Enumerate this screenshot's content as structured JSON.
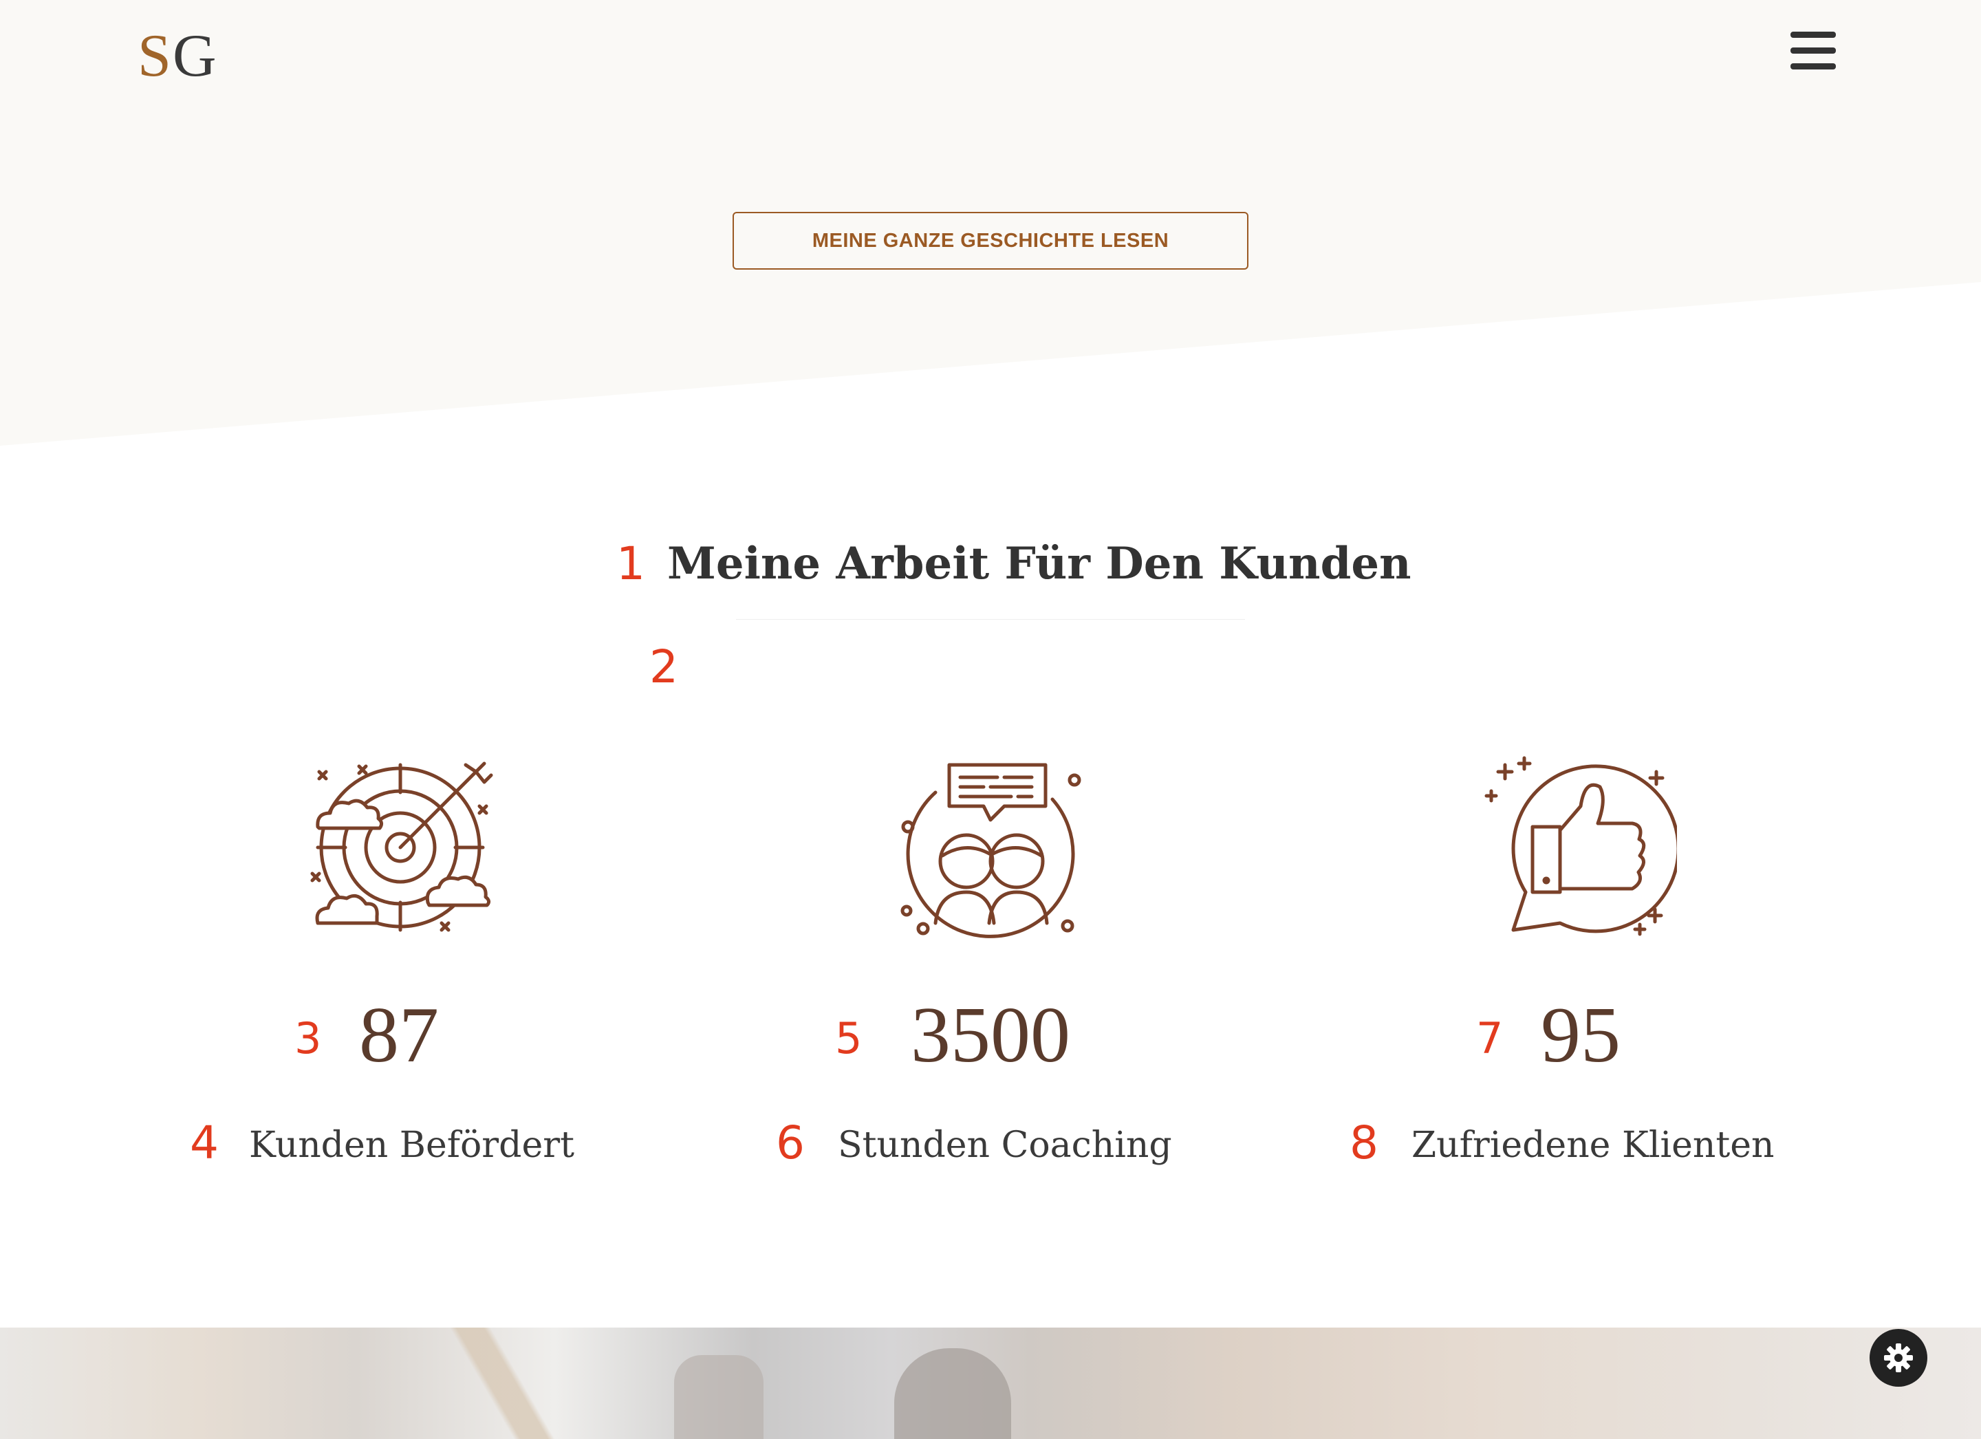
{
  "header": {
    "logo_s": "S",
    "logo_g": "G",
    "menu_icon": "hamburger-icon"
  },
  "hero": {
    "button_label": "MEINE GANZE GESCHICHTE LESEN"
  },
  "section": {
    "title": "Meine Arbeit Für Den Kunden",
    "markers": [
      "1",
      "2",
      "3",
      "4",
      "5",
      "6",
      "7",
      "8"
    ]
  },
  "stats": [
    {
      "icon": "target-arrow-icon",
      "value": "87",
      "label": "Kunden Befördert"
    },
    {
      "icon": "coaching-chat-icon",
      "value": "3500",
      "label": "Stunden Coaching"
    },
    {
      "icon": "thumbs-up-icon",
      "value": "95",
      "label": "Zufriedene Klienten"
    }
  ],
  "settings": {
    "icon": "gear-icon"
  },
  "colors": {
    "accent": "#9b5a24",
    "stat_value": "#5a3b2c",
    "marker": "#e23b1e",
    "hero_bg": "#faf9f6",
    "icon_stroke": "#7a4129"
  }
}
